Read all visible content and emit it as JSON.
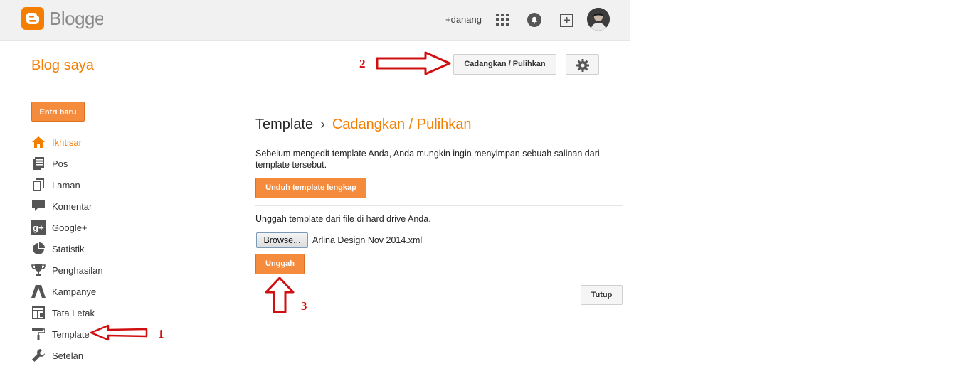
{
  "header": {
    "brand": "Blogger",
    "user": "+danang",
    "icons": [
      "apps-grid-icon",
      "notifications-bell-icon",
      "add-post-icon"
    ]
  },
  "sidebar": {
    "blog_title": "Blog saya",
    "new_post": "Entri baru",
    "items": [
      {
        "label": "Ikhtisar",
        "icon": "home-icon"
      },
      {
        "label": "Pos",
        "icon": "posts-icon"
      },
      {
        "label": "Laman",
        "icon": "pages-icon"
      },
      {
        "label": "Komentar",
        "icon": "comment-icon"
      },
      {
        "label": "Google+",
        "icon": "google-plus-icon"
      },
      {
        "label": "Statistik",
        "icon": "pie-chart-icon"
      },
      {
        "label": "Penghasilan",
        "icon": "trophy-icon"
      },
      {
        "label": "Kampanye",
        "icon": "adwords-icon"
      },
      {
        "label": "Tata Letak",
        "icon": "layout-icon"
      },
      {
        "label": "Template",
        "icon": "paint-roller-icon"
      },
      {
        "label": "Setelan",
        "icon": "wrench-icon"
      }
    ]
  },
  "toolbar": {
    "backup_restore": "Cadangkan / Pulihkan"
  },
  "main": {
    "breadcrumb_parent": "Template",
    "breadcrumb_sep": "›",
    "breadcrumb_current": "Cadangkan / Pulihkan",
    "description": "Sebelum mengedit template Anda, Anda mungkin ingin menyimpan sebuah salinan dari template tersebut.",
    "download_button": "Unduh template lengkap",
    "upload_label": "Unggah template dari file di hard drive Anda.",
    "browse_button": "Browse...",
    "file_name": "Arlina Design Nov 2014.xml",
    "upload_button": "Unggah",
    "close_button": "Tutup"
  },
  "annotations": {
    "step1": "1",
    "step2": "2",
    "step3": "3",
    "color": "#d01010"
  },
  "colors": {
    "accent": "#f57d00",
    "button_orange": "#f58b3d"
  }
}
